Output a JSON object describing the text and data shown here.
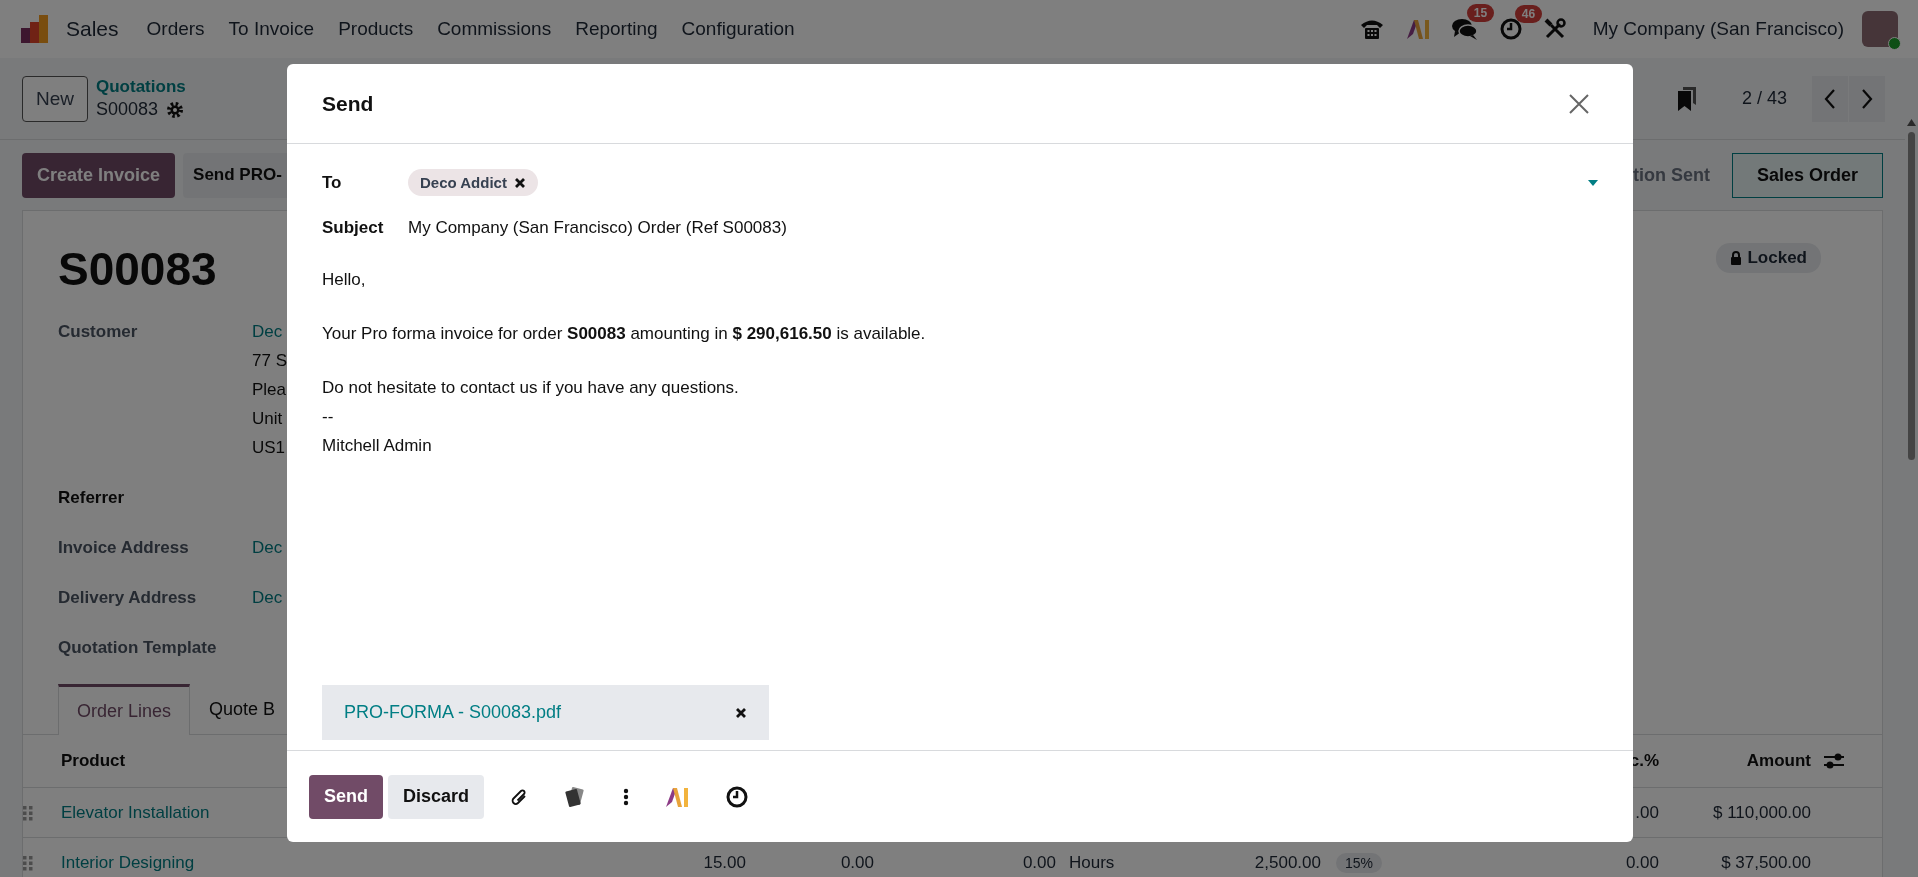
{
  "navbar": {
    "app": "Sales",
    "menu": [
      "Orders",
      "To Invoice",
      "Products",
      "Commissions",
      "Reporting",
      "Configuration"
    ],
    "badges": [
      {
        "kind": "messages",
        "count": "15"
      },
      {
        "kind": "activities",
        "count": "46"
      }
    ],
    "company": "My Company (San Francisco)"
  },
  "control_panel": {
    "new_button": "New",
    "breadcrumb": "Quotations",
    "record": "S00083",
    "pager": "2 / 43"
  },
  "status_bar": {
    "buttons": [
      {
        "label": "Create Invoice",
        "kind": "primary"
      },
      {
        "label": "Send PRO-",
        "kind": "secondary"
      }
    ],
    "stages": [
      {
        "label": "tion Sent",
        "selected": false
      },
      {
        "label": "Sales Order",
        "selected": true
      }
    ]
  },
  "form": {
    "title": "S00083",
    "badge": "Locked",
    "fields": [
      {
        "label": "Customer",
        "kind": "field",
        "values": [
          {
            "text": "Dec",
            "link": true
          },
          {
            "text": "77 S",
            "link": false
          },
          {
            "text": "Plea",
            "link": false
          },
          {
            "text": "Unit",
            "link": false
          },
          {
            "text": "US1",
            "link": false
          }
        ]
      },
      {
        "label": "Referrer",
        "kind": "heading"
      },
      {
        "label": "Invoice Address",
        "kind": "field",
        "values": [
          {
            "text": "Dec",
            "link": true
          }
        ]
      },
      {
        "label": "Delivery Address",
        "kind": "field",
        "values": [
          {
            "text": "Dec",
            "link": true
          }
        ]
      },
      {
        "label": "Quotation Template",
        "kind": "field"
      }
    ],
    "tabs": [
      {
        "label": "Order Lines",
        "selected": true
      },
      {
        "label": "Quote B",
        "selected": false
      }
    ],
    "table": {
      "columns": {
        "product": "Product",
        "column_9": "c.%",
        "amount": "Amount"
      },
      "rows": [
        {
          "product": "Elevator Installation",
          "column_9": ".00",
          "amount": "$ 110,000.00"
        },
        {
          "product": "Interior Designing",
          "column_2": "15.00",
          "column_3": "0.00",
          "column_4": "0.00",
          "column_5": "Hours",
          "column_6": "2,500.00",
          "column_7": "15%",
          "column_9": "0.00",
          "amount": "$ 37,500.00"
        }
      ]
    }
  },
  "dialog": {
    "title": "Send",
    "to_label": "To",
    "recipients": [
      "Deco Addict"
    ],
    "subject_label": "Subject",
    "subject": "My Company (San Francisco) Order (Ref S00083)",
    "body": [
      {
        "lines": [
          "Hello,"
        ]
      },
      {
        "lines": [
          "Your Pro forma invoice for order **S00083** amounting in **$ 290,616.50** is available."
        ]
      },
      {
        "lines": [
          "Do not hesitate to contact us if you have any questions.",
          "--",
          "Mitchell Admin"
        ]
      }
    ],
    "attachments": [
      "PRO-FORMA - S00083.pdf"
    ],
    "buttons": [
      {
        "label": "Send",
        "kind": "primary"
      },
      {
        "label": "Discard",
        "kind": "secondary"
      }
    ]
  }
}
